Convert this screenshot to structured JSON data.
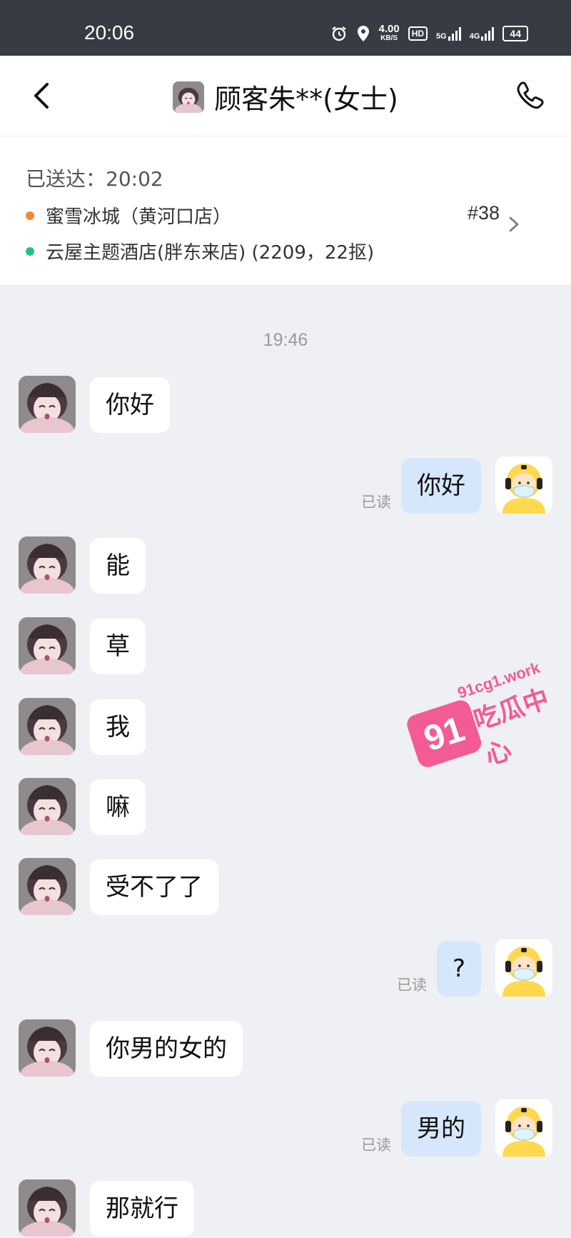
{
  "status_bar": {
    "time": "20:06",
    "net_speed": "4.00",
    "net_speed_unit": "KB/S",
    "hd_label": "HD",
    "signal_1": "5G",
    "signal_2": "4G",
    "battery": "44"
  },
  "nav": {
    "title": "顾客朱**(女士)"
  },
  "order": {
    "delivered_label": "已送达：20:02",
    "store": "蜜雪冰城（黄河口店）",
    "address": "云屋主题酒店(胖东来店) (2209，22抠)",
    "order_no": "#38",
    "store_dot_color": "#f0883a",
    "address_dot_color": "#22c08a"
  },
  "chat": {
    "timestamp": "19:46",
    "read_label": "已读",
    "messages": [
      {
        "side": "in",
        "text": "你好"
      },
      {
        "side": "out",
        "text": "你好",
        "read": "已读"
      },
      {
        "side": "in",
        "text": "能"
      },
      {
        "side": "in",
        "text": "草"
      },
      {
        "side": "in",
        "text": "我"
      },
      {
        "side": "in",
        "text": "嘛"
      },
      {
        "side": "in",
        "text": "受不了了"
      },
      {
        "side": "out",
        "text": "?",
        "read": "已读"
      },
      {
        "side": "in",
        "text": "你男的女的"
      },
      {
        "side": "out",
        "text": "男的",
        "read": "已读"
      },
      {
        "side": "in",
        "text": "那就行"
      }
    ]
  },
  "watermark": {
    "logo": "91",
    "url": "91cg1.work",
    "name": "吃瓜中心"
  },
  "colors": {
    "accent_bubble_out": "#d6e7fb",
    "statusbar_bg": "#373b44",
    "watermark": "#f35b95"
  }
}
